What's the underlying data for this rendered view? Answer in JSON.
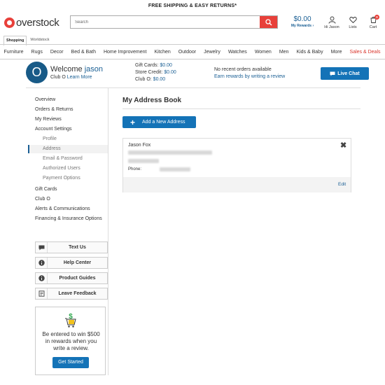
{
  "promo_banner": "FREE SHIPPING & EASY RETURNS*",
  "header": {
    "logo_text": "overstock",
    "search_placeholder": "Search",
    "rewards_amount": "$0.00",
    "rewards_label": "My Rewards ›",
    "account_label": "Hi Jason",
    "lists_label": "Lists",
    "cart_label": "Cart",
    "cart_count": "0"
  },
  "tabs": [
    "Shopping",
    "Worldstock"
  ],
  "categories": [
    "Furniture",
    "Rugs",
    "Decor",
    "Bed & Bath",
    "Home Improvement",
    "Kitchen",
    "Outdoor",
    "Jewelry",
    "Watches",
    "Women",
    "Men",
    "Kids & Baby",
    "More",
    "Sales & Deals"
  ],
  "welcome": {
    "avatar_letter": "O",
    "greeting": "Welcome",
    "user_name": "jason",
    "club_prefix": "Club O",
    "learn_more": "Learn More",
    "gift_cards_label": "Gift Cards:",
    "gift_cards_value": "$0.00",
    "store_credit_label": "Store Credit:",
    "store_credit_value": "$0.00",
    "club_o_label": "Club O:",
    "club_o_value": "$0.00",
    "orders_text": "No recent orders available",
    "earn_text": "Earn rewards by writing a review",
    "chat_label": "Live Chat"
  },
  "sidebar": {
    "overview": "Overview",
    "orders_returns": "Orders & Returns",
    "my_reviews": "My Reviews",
    "account_settings": "Account Settings",
    "profile": "Profile",
    "address": "Address",
    "email_password": "Email & Password",
    "authorized_users": "Authorized Users",
    "payment_options": "Payment Options",
    "gift_cards": "Gift Cards",
    "club_o": "Club O",
    "alerts": "Alerts & Communications",
    "financing": "Financing & Insurance Options",
    "text_us": "Text Us",
    "help_center": "Help Center",
    "product_guides": "Product Guides",
    "leave_feedback": "Leave Feedback",
    "promo_text": "Be entered to win $500 in rewards when you write a review.",
    "promo_button": "Get Started"
  },
  "main": {
    "title": "My Address Book",
    "add_button": "Add a New Address",
    "address_name": "Jason Fox",
    "phone_label": "Phone:",
    "edit_label": "Edit",
    "close_glyph": "✖"
  },
  "colors": {
    "brand_red": "#e8403a",
    "link_blue": "#1a5f94",
    "button_blue": "#1473b7"
  }
}
